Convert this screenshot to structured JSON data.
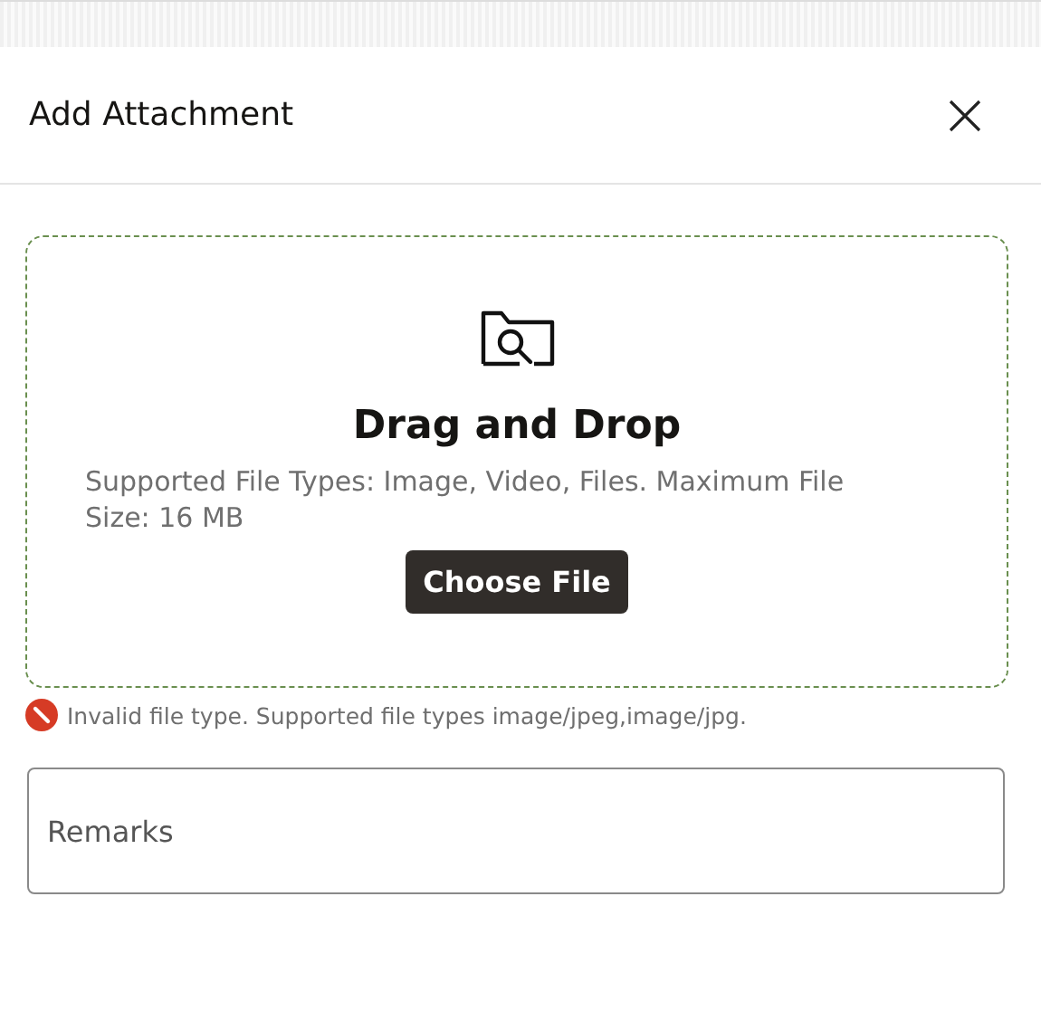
{
  "dialog": {
    "title": "Add Attachment"
  },
  "drop_zone": {
    "heading": "Drag and Drop",
    "hint": "Supported File Types: Image, Video, Files. Maximum File Size: 16 MB",
    "button": "Choose File"
  },
  "error": {
    "message": "Invalid file type. Supported file types image/jpeg,image/jpg."
  },
  "remarks": {
    "placeholder": "Remarks"
  }
}
